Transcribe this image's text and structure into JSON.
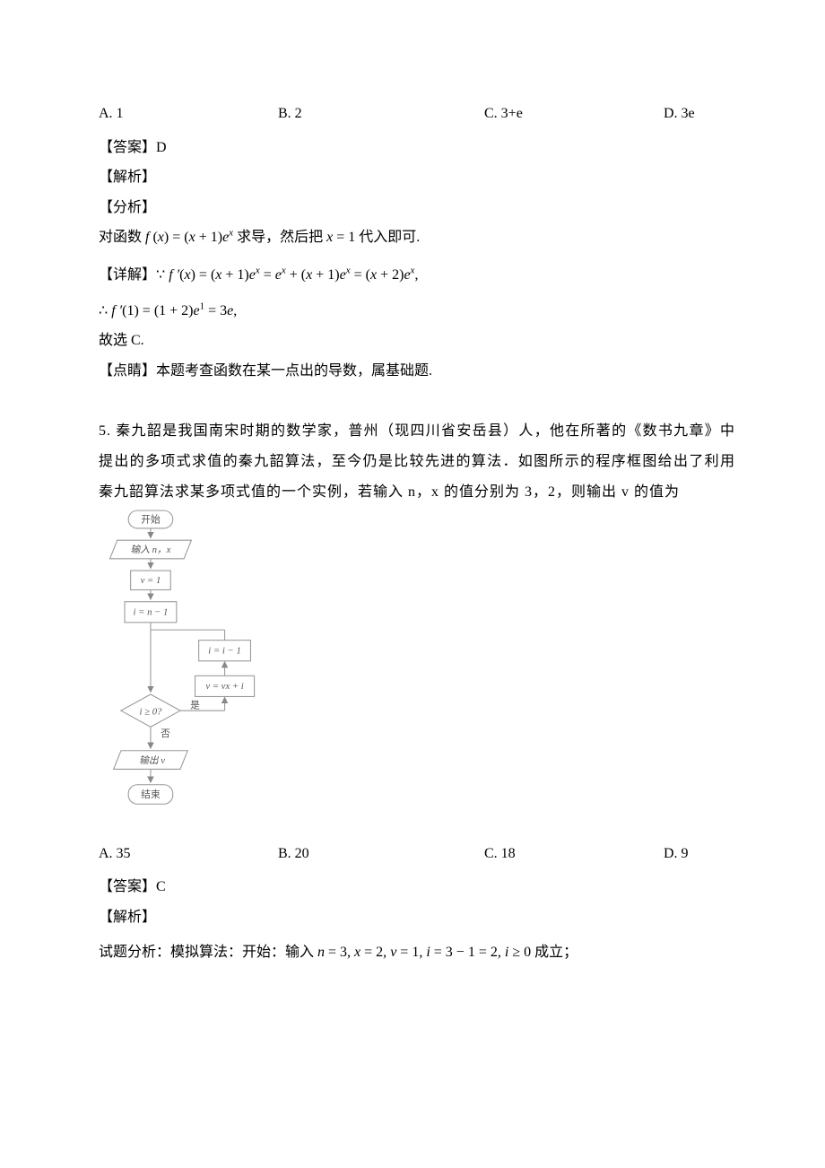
{
  "q4": {
    "options": {
      "a": "A.  1",
      "b": "B.  2",
      "c": "C.  3+e",
      "d": "D.  3e"
    },
    "answer_label": "【答案】D",
    "jiexi_label": "【解析】",
    "fenxi_label": "【分析】",
    "fenxi_text_pre": "对函数",
    "fenxi_text_post": "求导，然后把",
    "fenxi_text_end": "代入即可.",
    "xiangjie_label": "【详解】",
    "gu": "故选 C.",
    "dianqing_label": "【点睛】",
    "dianqing_text": "本题考查函数在某一点出的导数，属基础题."
  },
  "q5": {
    "number": "5. ",
    "text": "秦九韶是我国南宋时期的数学家，普州（现四川省安岳县）人，他在所著的《数书九章》中提出的多项式求值的秦九韶算法，至今仍是比较先进的算法．如图所示的程序框图给出了利用秦九韶算法求某多项式值的一个实例，若输入 n，x 的值分别为 3，2，则输出 v 的值为",
    "options": {
      "a": "A.  35",
      "b": "B.  20",
      "c": "C.  18",
      "d": "D.  9"
    },
    "answer_label": "【答案】C",
    "jiexi_label": "【解析】",
    "fenxi_label": "试题分析：模拟算法：开始：输入",
    "fenxi_text": "成立；"
  },
  "flowchart": {
    "start": "开始",
    "input": "输入 n，x",
    "step1": "v = 1",
    "step2": "i = n − 1",
    "branch_yes": "i = i − 1",
    "branch_body": "v = vx + i",
    "cond": "i ≥ 0?",
    "yes": "是",
    "no": "否",
    "output": "输出 v",
    "end": "结束"
  },
  "chart_data": {
    "type": "table",
    "title": "Flowchart steps",
    "steps": [
      {
        "kind": "terminator",
        "label": "开始"
      },
      {
        "kind": "io",
        "label": "输入 n，x"
      },
      {
        "kind": "process",
        "label": "v = 1"
      },
      {
        "kind": "process",
        "label": "i = n − 1"
      },
      {
        "kind": "decision",
        "label": "i ≥ 0?",
        "yes_to": "v = vx + i → i = i − 1 → decision",
        "no_to": "输出 v"
      },
      {
        "kind": "io",
        "label": "输出 v"
      },
      {
        "kind": "terminator",
        "label": "结束"
      }
    ]
  }
}
